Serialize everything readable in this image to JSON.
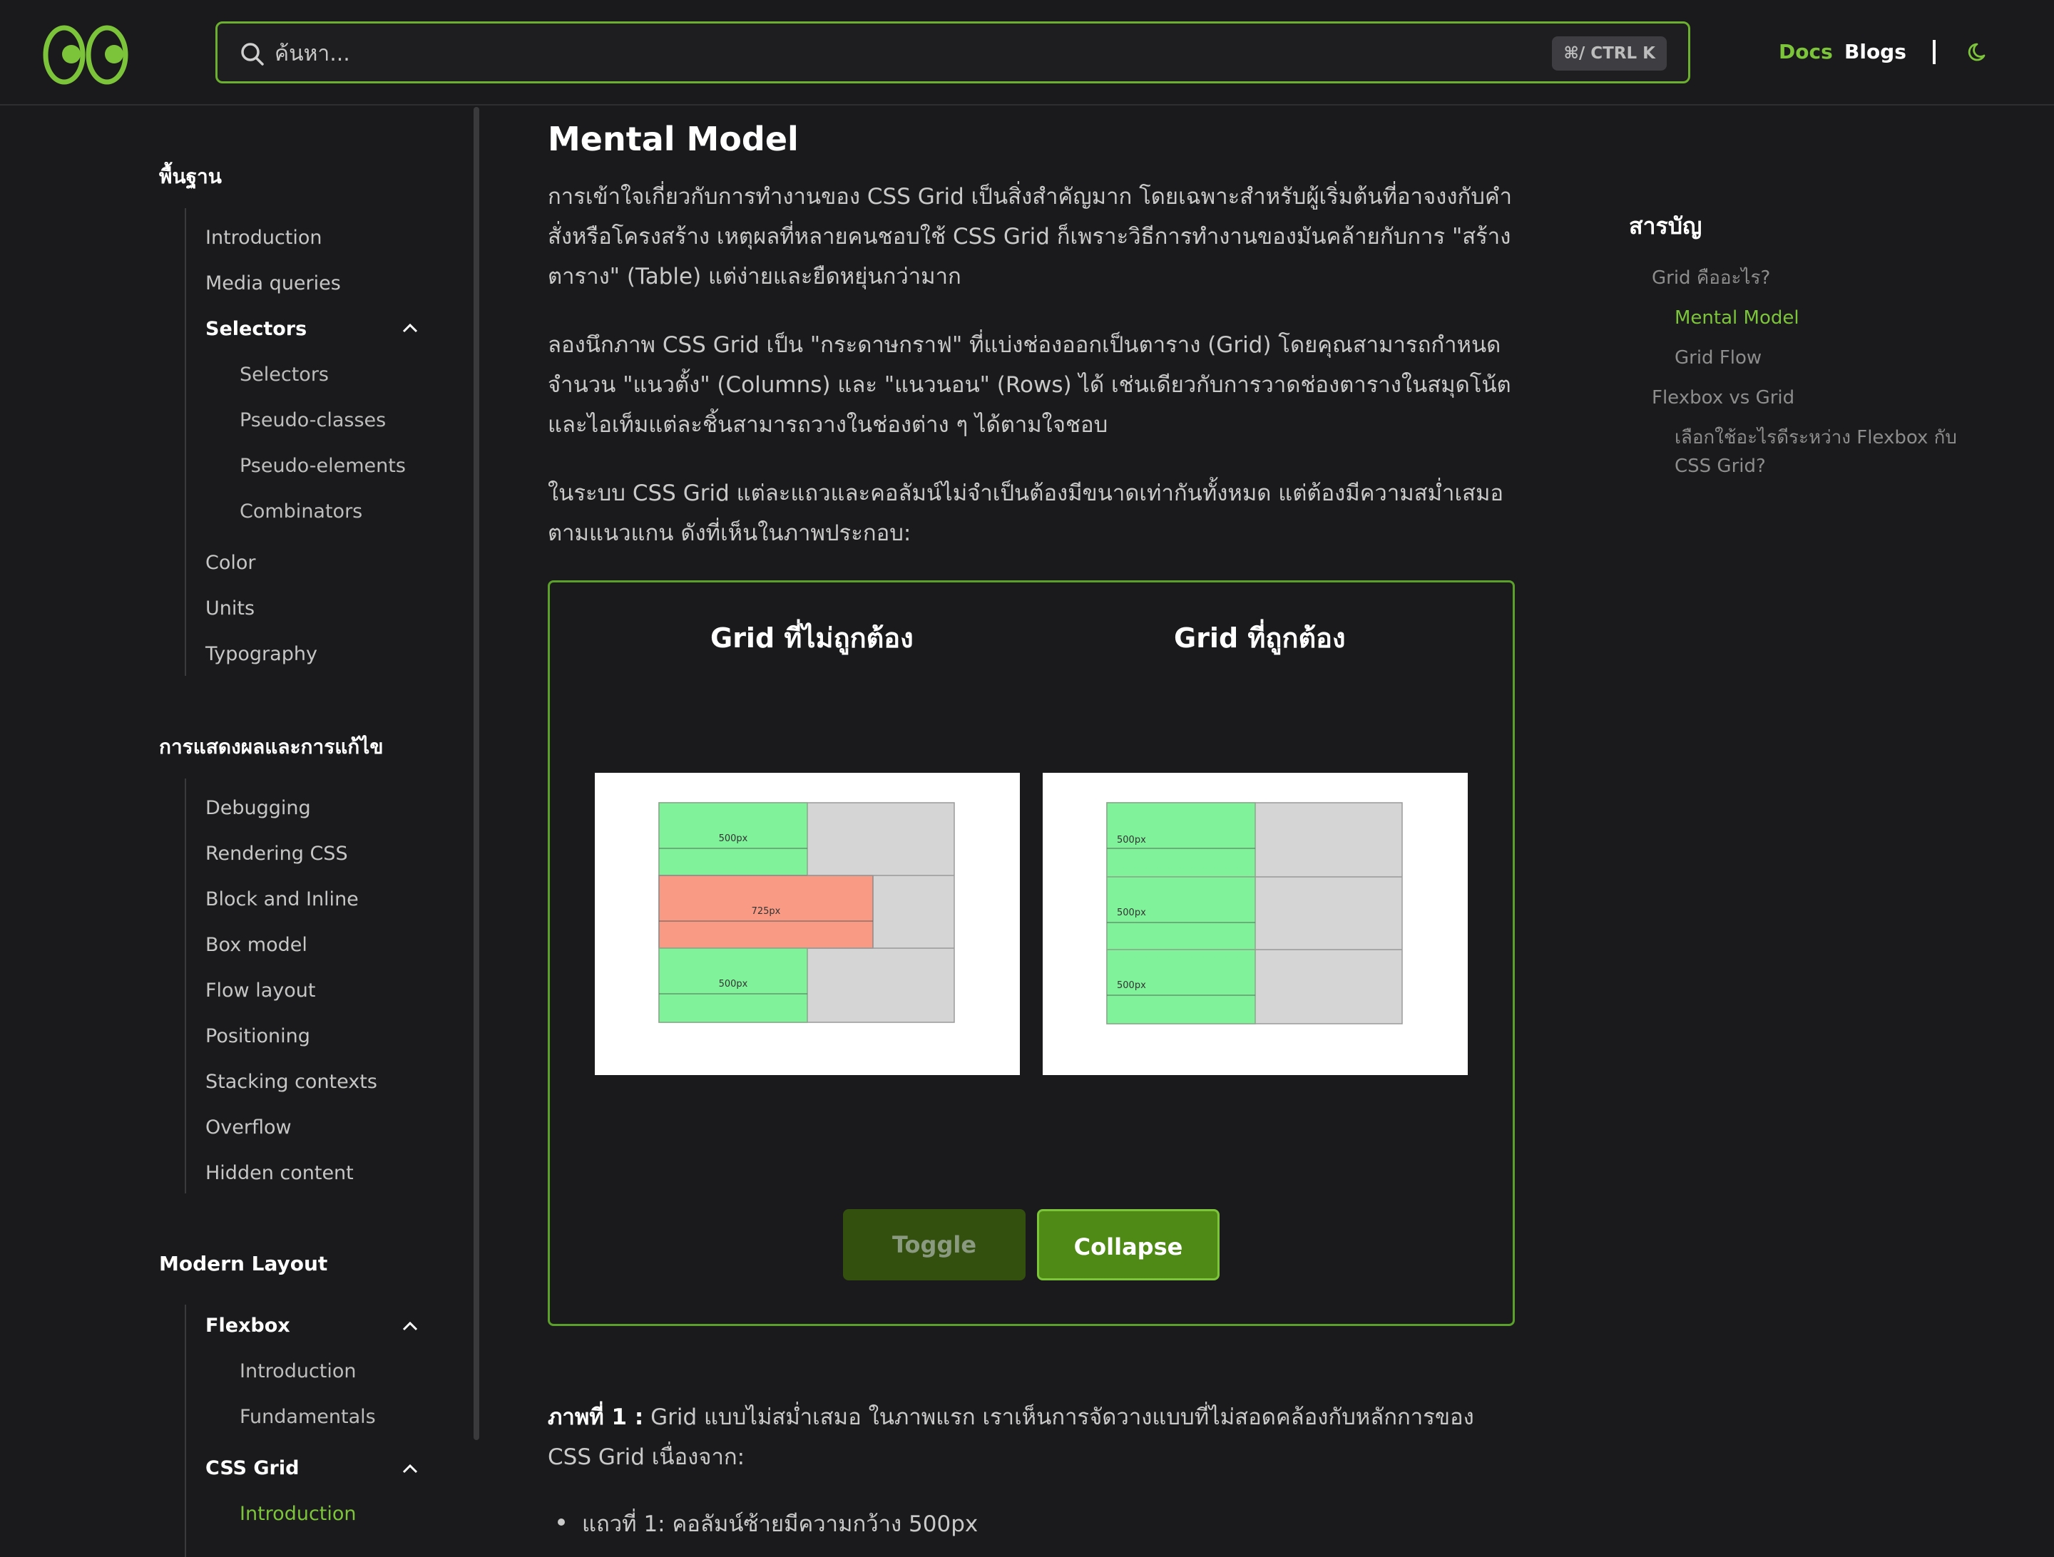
{
  "header": {
    "search_placeholder": "ค้นหา...",
    "shortcut": "⌘/ CTRL K",
    "nav": {
      "docs": "Docs",
      "blogs": "Blogs"
    },
    "accent": "#7cc43a"
  },
  "sidebar": {
    "section1": {
      "title": "พื้นฐาน",
      "items": [
        "Introduction",
        "Media queries"
      ],
      "group": {
        "label": "Selectors",
        "children": [
          "Selectors",
          "Pseudo-classes",
          "Pseudo-elements",
          "Combinators"
        ]
      },
      "items2": [
        "Color",
        "Units",
        "Typography"
      ]
    },
    "section2": {
      "title": "การแสดงผลและการแก้ไข",
      "items": [
        "Debugging",
        "Rendering CSS",
        "Block and Inline",
        "Box model",
        "Flow layout",
        "Positioning",
        "Stacking contexts",
        "Overflow",
        "Hidden content"
      ]
    },
    "section3": {
      "title": "Modern Layout",
      "flexbox": {
        "label": "Flexbox",
        "children": [
          "Introduction",
          "Fundamentals"
        ]
      },
      "grid": {
        "label": "CSS Grid",
        "children": [
          "Introduction"
        ]
      }
    }
  },
  "main": {
    "title": "Mental Model",
    "p1": "การเข้าใจเกี่ยวกับการทำงานของ CSS Grid เป็นสิ่งสำคัญมาก โดยเฉพาะสำหรับผู้เริ่มต้นที่อาจงงกับคำสั่งหรือโครงสร้าง เหตุผลที่หลายคนชอบใช้ CSS Grid ก็เพราะวิธีการทำงานของมันคล้ายกับการ \"สร้างตาราง\" (Table) แต่ง่ายและยืดหยุ่นกว่ามาก",
    "p2": "ลองนึกภาพ CSS Grid เป็น \"กระดาษกราฟ\" ที่แบ่งช่องออกเป็นตาราง (Grid) โดยคุณสามารถกำหนดจำนวน \"แนวตั้ง\" (Columns) และ \"แนวนอน\" (Rows) ได้ เช่นเดียวกับการวาดช่องตารางในสมุดโน้ต และไอเท็มแต่ละชิ้นสามารถวางในช่องต่าง ๆ ได้ตามใจชอบ",
    "p3": "ในระบบ CSS Grid แต่ละแถวและคอลัมน์ไม่จำเป็นต้องมีขนาดเท่ากันทั้งหมด แต่ต้องมีความสม่ำเสมอตามแนวแกน ดังที่เห็นในภาพประกอบ:",
    "demo": {
      "left_title": "Grid ที่ไม่ถูกต้อง",
      "right_title": "Grid ที่ถูกต้อง",
      "left_rows": [
        "500px",
        "725px",
        "500px"
      ],
      "right_rows": [
        "500px",
        "500px",
        "500px"
      ],
      "toggle": "Toggle",
      "collapse": "Collapse"
    },
    "caption_label": "ภาพที่ 1 :",
    "caption_text": " Grid แบบไม่สม่ำเสมอ ในภาพแรก เราเห็นการจัดวางแบบที่ไม่สอดคล้องกับหลักการของ CSS Grid เนื่องจาก:",
    "bullet1": "แถวที่ 1: คอลัมน์ซ้ายมีความกว้าง 500px"
  },
  "toc": {
    "title": "สารบัญ",
    "items": [
      "Grid คืออะไร?",
      "Mental Model",
      "Grid Flow",
      "Flexbox vs Grid",
      "เลือกใช้อะไรดีระหว่าง Flexbox กับ CSS Grid?"
    ]
  }
}
